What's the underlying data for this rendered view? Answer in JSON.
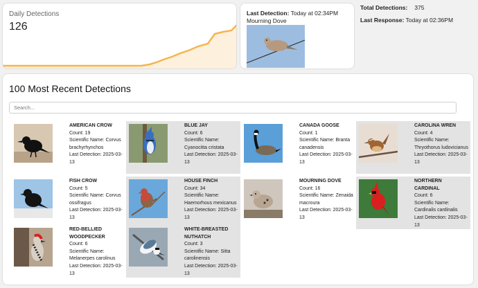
{
  "daily": {
    "label": "Daily Detections",
    "value": "126",
    "colors": {
      "line": "#f6b44e",
      "fill": "#fdf0dc"
    }
  },
  "last_detection": {
    "label": "Last Detection:",
    "time": "Today at 02:34PM",
    "species": "Mourning Dove"
  },
  "stats": {
    "total_label": "Total Detections:",
    "total_value": "375",
    "response_label": "Last Response:",
    "response_value": "Today at 02:36PM"
  },
  "recent": {
    "title": "100 Most Recent Detections",
    "search_placeholder": "Search...",
    "count_prefix": "Count: ",
    "sci_prefix": "Scientific Name: ",
    "last_prefix": "Last Detection: ",
    "items": [
      {
        "name": "American Crow",
        "count": "19",
        "scientific": "Corvus brachyrhynchos",
        "last": "2025-03-13"
      },
      {
        "name": "Blue Jay",
        "count": "6",
        "scientific": "Cyanocitta cristata",
        "last": "2025-03-13"
      },
      {
        "name": "Canada Goose",
        "count": "1",
        "scientific": "Branta canadensis",
        "last": "2025-03-13"
      },
      {
        "name": "Carolina Wren",
        "count": "4",
        "scientific": "Thryothorus ludovicianus",
        "last": "2025-03-13"
      },
      {
        "name": "Fish Crow",
        "count": "5",
        "scientific": "Corvus ossifragus",
        "last": "2025-03-13"
      },
      {
        "name": "House Finch",
        "count": "34",
        "scientific": "Haemorhous mexicanus",
        "last": "2025-03-13"
      },
      {
        "name": "Mourning Dove",
        "count": "16",
        "scientific": "Zenaida macroura",
        "last": "2025-03-13"
      },
      {
        "name": "Northern Cardinal",
        "count": "6",
        "scientific": "Cardinalis cardinalis",
        "last": "2025-03-13"
      },
      {
        "name": "Red-bellied Woodpecker",
        "count": "6",
        "scientific": "Melanerpes carolinus",
        "last": "2025-03-13"
      },
      {
        "name": "White-breasted Nuthatch",
        "count": "3",
        "scientific": "Sitta carolinensis",
        "last": "2025-03-13"
      }
    ]
  }
}
